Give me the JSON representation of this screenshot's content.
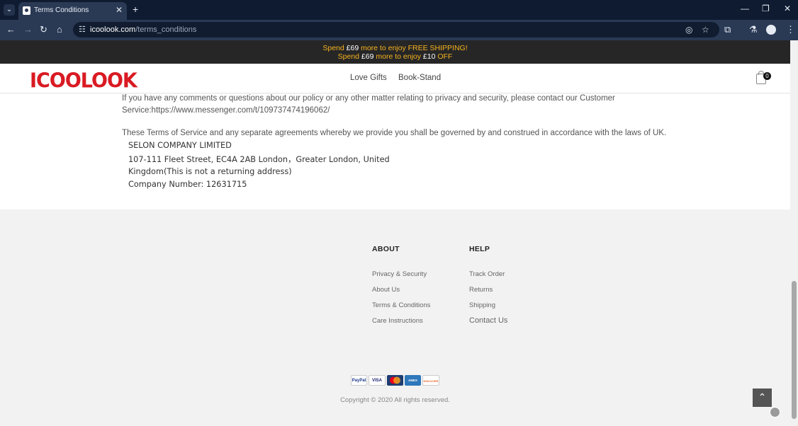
{
  "browser": {
    "tab_title": "Terms Conditions",
    "url_domain": "icoolook.com",
    "url_path": "/terms_conditions",
    "icons": [
      "tab-list-icon",
      "close-icon",
      "plus-icon",
      "minimize-icon",
      "restore-icon",
      "back-icon",
      "forward-icon",
      "reload-icon",
      "home-icon",
      "site-info-icon",
      "eye-off-icon",
      "star-icon",
      "extensions-icon",
      "labs-icon",
      "profile-icon",
      "menu-icon"
    ]
  },
  "promo": {
    "line1_a": "Spend ",
    "line1_amount": "£69",
    "line1_b": " more to enjoy FREE SHIPPING!",
    "line2_a": "Spend ",
    "line2_amount": "£69",
    "line2_b": " more to enjoy ",
    "line2_amount2": "£10",
    "line2_c": " OFF"
  },
  "header": {
    "logo": "ICOOLOOK",
    "nav": [
      "Love Gifts",
      "Book-Stand"
    ],
    "cart_count": "0"
  },
  "content": {
    "contact_text": "If you have any comments or questions about our policy or any other matter relating to privacy and security, please contact our Customer",
    "contact_label": "Service:",
    "contact_link": "https://www.messenger.com/t/109737474196062/",
    "law_text": "These Terms of Service and any separate agreements whereby we provide you shall be governed by and construed in accordance with the laws of UK.",
    "address": [
      "SELON COMPANY LIMITED",
      "107-111 Fleet Street, EC4A 2AB London，Greater London, United",
      "Kingdom(This is not a returning address)",
      "Company Number: 12631715"
    ]
  },
  "footer": {
    "about_heading": "ABOUT",
    "about_links": [
      "Privacy & Security",
      "About Us",
      "Terms & Conditions",
      "Care Instructions"
    ],
    "help_heading": "HELP",
    "help_links": [
      "Track Order",
      "Returns",
      "Shipping",
      "Contact Us"
    ],
    "payments": [
      "PayPal",
      "VISA",
      "Mastercard",
      "AMEX",
      "DISCOVER"
    ],
    "copyright": "Copyright © 2020 All rights reserved."
  },
  "colors": {
    "promo_bg": "#262626",
    "promo_text": "#f7b21f",
    "logo_red": "#d91a22",
    "footer_bg": "#f2f2f2",
    "chrome_dark": "#0f1b30",
    "chrome_toolbar": "#2a3954"
  }
}
